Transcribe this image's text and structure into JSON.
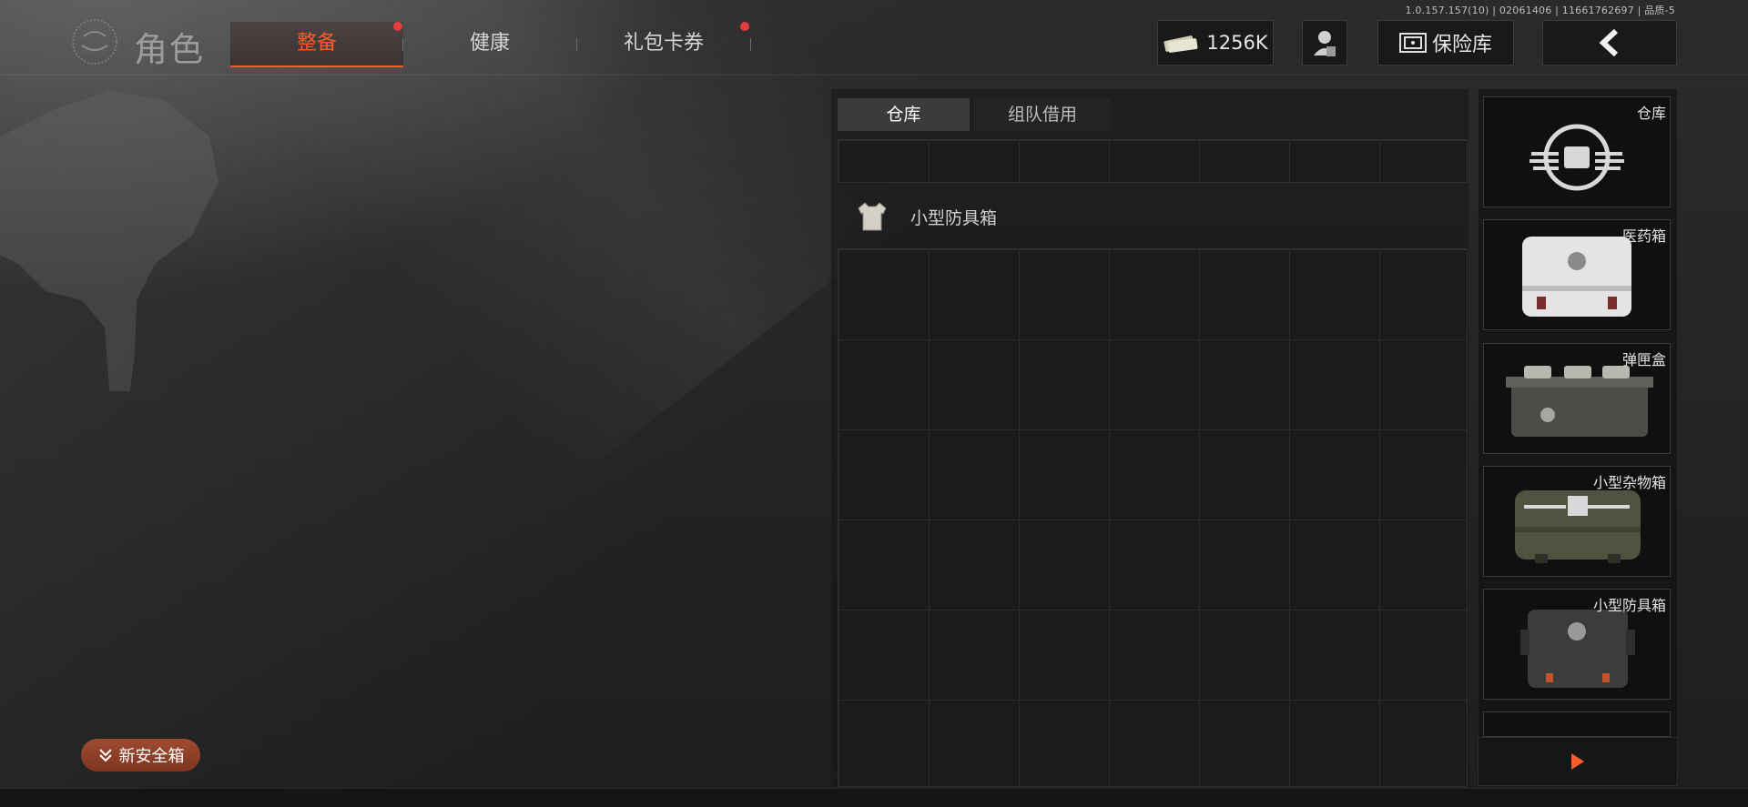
{
  "version": "1.0.157.157(10) | 02061406 | 11661762697 | 品质-5",
  "header": {
    "title": "角色",
    "tabs": [
      {
        "label": "整备",
        "active": true,
        "badge": true
      },
      {
        "label": "健康",
        "active": false,
        "badge": false
      },
      {
        "label": "礼包卡券",
        "active": false,
        "badge": true
      }
    ],
    "currency": "1256K",
    "vault_label": "保险库",
    "back_icon": "chevron-left-icon",
    "support_icon": "agent-icon"
  },
  "storage": {
    "tabs": [
      {
        "label": "仓库",
        "active": true
      },
      {
        "label": "组队借用",
        "active": false
      }
    ],
    "selected_item": {
      "label": "小型防具箱",
      "icon": "armor-vest-icon"
    }
  },
  "containers": [
    {
      "label": "仓库",
      "icon": "warehouse-emblem-icon"
    },
    {
      "label": "医药箱",
      "icon": "medical-case-icon"
    },
    {
      "label": "弹匣盒",
      "icon": "ammo-box-icon"
    },
    {
      "label": "小型杂物箱",
      "icon": "sundries-case-icon"
    },
    {
      "label": "小型防具箱",
      "icon": "armor-case-icon"
    }
  ],
  "new_safe_box_label": "新安全箱",
  "colors": {
    "accent": "#ff5a2a",
    "badge": "#e53b3b"
  }
}
